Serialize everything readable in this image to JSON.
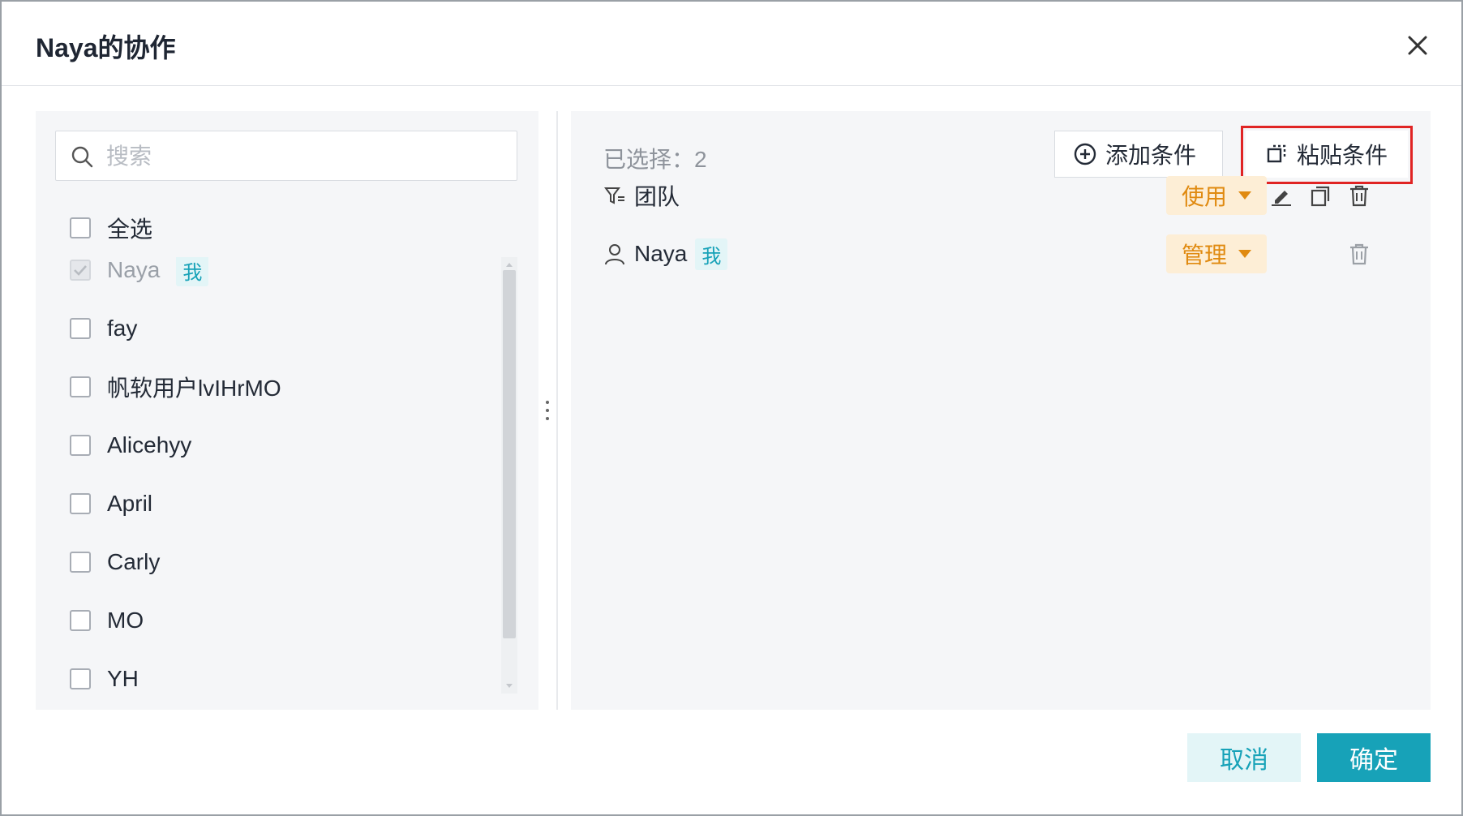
{
  "dialog": {
    "title": "Naya的协作",
    "close_icon": "close-icon"
  },
  "left_panel": {
    "search_placeholder": "搜索",
    "select_all_label": "全选",
    "me_tag": "我",
    "users": [
      {
        "name": "Naya",
        "checked": true,
        "disabled": true,
        "is_me": true
      },
      {
        "name": "fay",
        "checked": false
      },
      {
        "name": "帆软用户lvIHrMO",
        "checked": false
      },
      {
        "name": "Alicehyy",
        "checked": false
      },
      {
        "name": "April",
        "checked": false
      },
      {
        "name": "Carly",
        "checked": false
      },
      {
        "name": "MO",
        "checked": false
      },
      {
        "name": "YH",
        "checked": false
      }
    ]
  },
  "right_panel": {
    "selected_count_label": "已选择：2",
    "add_condition_label": "添加条件",
    "paste_condition_label": "粘贴条件",
    "rows": [
      {
        "icon": "filter-icon",
        "name": "团队",
        "role": "使用"
      },
      {
        "icon": "user-icon",
        "name": "Naya",
        "me_tag": "我",
        "role": "管理"
      }
    ]
  },
  "footer": {
    "cancel_label": "取消",
    "ok_label": "确定"
  },
  "colors": {
    "accent": "#17a2b8",
    "role_bg": "#fdeed6",
    "role_text": "#e08a10",
    "highlight": "#e02424"
  }
}
